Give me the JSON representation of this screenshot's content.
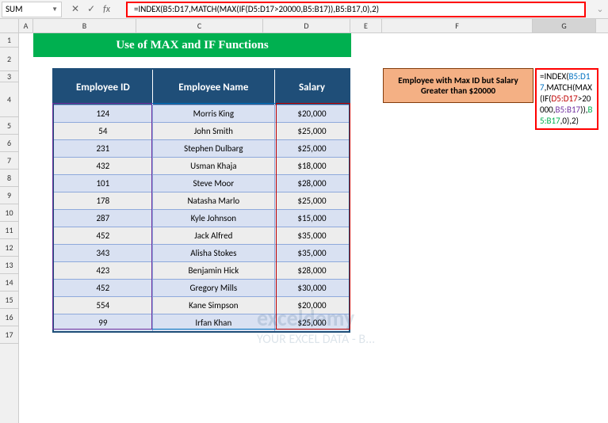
{
  "nameBox": "SUM",
  "formulaBar": "=INDEX(B5:D17,MATCH(MAX(IF(D5:D17>20000,B5:B17)),B5:B17,0),2)",
  "cols": [
    "A",
    "B",
    "C",
    "D",
    "E",
    "F",
    "G"
  ],
  "rows": [
    "1",
    "2",
    "3",
    "4",
    "5",
    "6",
    "7",
    "8",
    "9",
    "10",
    "11",
    "12",
    "13",
    "14",
    "15",
    "16",
    "17"
  ],
  "title": "Use of MAX and IF Functions",
  "headers": {
    "b": "Employee ID",
    "c": "Employee Name",
    "d": "Salary"
  },
  "data": [
    {
      "id": "124",
      "name": "Morris King",
      "sal": "$20,000"
    },
    {
      "id": "54",
      "name": "John Smith",
      "sal": "$25,000"
    },
    {
      "id": "231",
      "name": "Stephen Dulbarg",
      "sal": "$25,000"
    },
    {
      "id": "432",
      "name": "Usman Khaja",
      "sal": "$18,000"
    },
    {
      "id": "101",
      "name": "Steve Moor",
      "sal": "$28,000"
    },
    {
      "id": "178",
      "name": "Natasha Marlo",
      "sal": "$25,000"
    },
    {
      "id": "287",
      "name": "Kyle Johnson",
      "sal": "$15,000"
    },
    {
      "id": "452",
      "name": "Jack Alfred",
      "sal": "$35,000"
    },
    {
      "id": "343",
      "name": "Alisha Stokes",
      "sal": "$35,000"
    },
    {
      "id": "423",
      "name": "Benjamin Hick",
      "sal": "$28,000"
    },
    {
      "id": "452",
      "name": "Gregory Mills",
      "sal": "$30,000"
    },
    {
      "id": "554",
      "name": "Kane Simpson",
      "sal": "$20,000"
    },
    {
      "id": "99",
      "name": "Irfan Khan",
      "sal": "$25,000"
    }
  ],
  "orangeBox": "Employee with Max ID but Salary Greater than $20000",
  "cellFormula": {
    "p1": "=INDEX(",
    "p2": "B5:D17",
    "p3": ",MATCH(",
    "p4": "MAX(IF(",
    "p5": "D5:D17",
    "p6": ">20000,",
    "p7": "B5:B17",
    "p8": ")),",
    "p9": "B5:B17",
    "p10": ",0),2)"
  },
  "watermark": {
    "line1": "exceldemy",
    "line2": "YOUR EXCEL DATA - B..."
  }
}
